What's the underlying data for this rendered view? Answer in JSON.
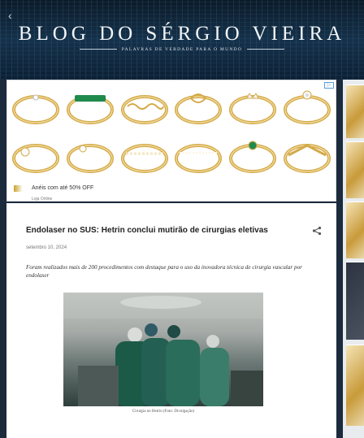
{
  "header": {
    "title": "BLOG DO SÉRGIO VIEIRA",
    "subtitle": "PALAVRAS DE VERDADE PARA O MUNDO"
  },
  "ad": {
    "headline": "Anéis com até 50% OFF",
    "brand": "Loja Online",
    "rings_top": [
      "solitaire-ring",
      "emerald-band-ring",
      "chain-link-ring",
      "knot-ring",
      "crown-ring",
      "flower-ring"
    ],
    "rings_bottom": [
      "halo-ring",
      "cluster-ring",
      "beaded-ring",
      "pave-band-ring",
      "emerald-solitaire-ring",
      "chevron-ring"
    ],
    "colors": {
      "gold": "#d4aa4a",
      "emerald": "#1f8a4c"
    }
  },
  "post": {
    "title": "Endolaser no SUS: Hetrin conclui mutirão de cirurgias eletivas",
    "date": "setembro 10, 2024",
    "body": "Foram realizados mais de 200 procedimentos com destaque para o uso da inovadora técnica de cirurgia vascular por endolaser",
    "caption": "Cirurgia no Hetrin (Foto: Divulgação)"
  },
  "icons": {
    "share": "share-icon",
    "back": "back-arrow-icon",
    "ad_choices": "ad-choices-icon"
  }
}
